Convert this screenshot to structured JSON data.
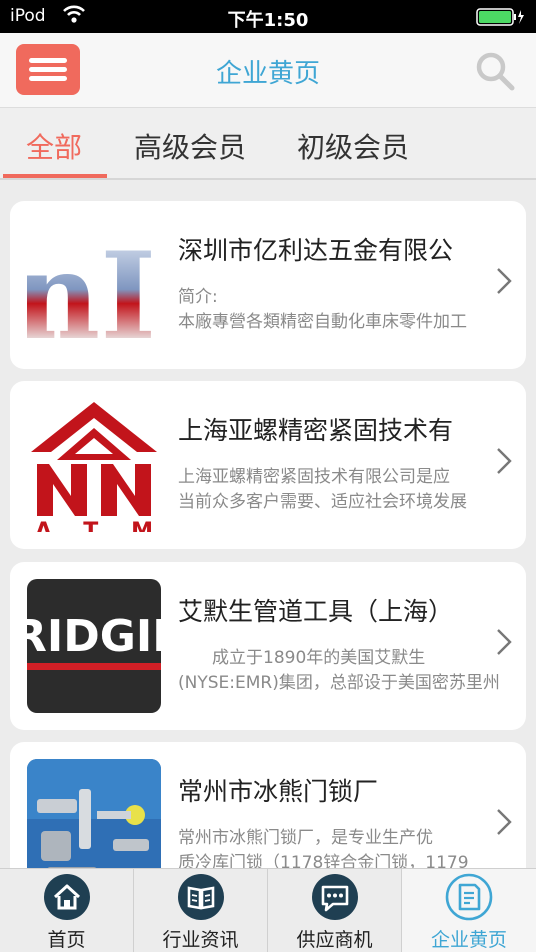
{
  "status_bar": {
    "carrier": "iPod",
    "time": "下午1:50"
  },
  "header": {
    "title": "企业黄页",
    "menu_icon": "hamburger-menu-icon",
    "search_icon": "search-icon",
    "accent": "#3fa6d4",
    "menu_color": "#f06a5d"
  },
  "tabs": [
    {
      "label": "全部",
      "active": true
    },
    {
      "label": "高级会员",
      "active": false
    },
    {
      "label": "初级会员",
      "active": false
    }
  ],
  "companies": [
    {
      "name": "深圳市亿利达五金有限公",
      "desc_line1": "简介:",
      "desc_line2": "本廠專營各類精密自動化車床零件加工",
      "logo_text": "nIc"
    },
    {
      "name": "上海亚螺精密紧固技术有",
      "desc_line1": "上海亚螺精密紧固技术有限公司是应",
      "desc_line2": "当前众多客户需要、适应社会环境发展",
      "logo_text": "ATM"
    },
    {
      "name": "艾默生管道工具（上海）",
      "desc_line1": "　　成立于1890年的美国艾默生",
      "desc_line2": "(NYSE:EMR)集团，总部设于美国密苏里州",
      "logo_text": "RIDGID"
    },
    {
      "name": "常州市冰熊门锁厂",
      "desc_line1": " 常州市冰熊门锁厂，是专业生产优",
      "desc_line2": "质冷库门锁（1178锌合金门锁，1179",
      "logo_text": ""
    }
  ],
  "bottom_nav": [
    {
      "label": "首页",
      "icon": "home-icon",
      "active": false
    },
    {
      "label": "行业资讯",
      "icon": "book-icon",
      "active": false
    },
    {
      "label": "供应商机",
      "icon": "chat-icon",
      "active": false
    },
    {
      "label": "企业黄页",
      "icon": "document-icon",
      "active": true
    }
  ]
}
